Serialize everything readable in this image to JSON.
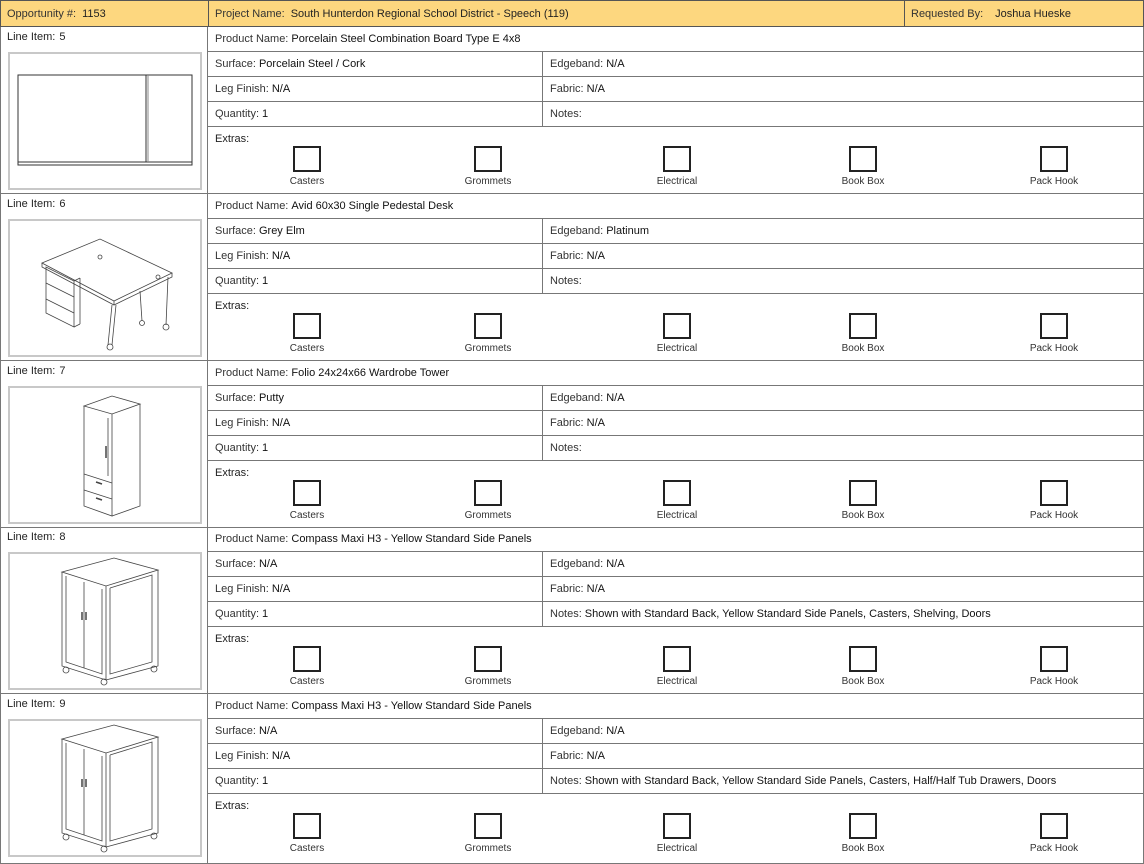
{
  "header": {
    "opportunity_label": "Opportunity #:",
    "opportunity_value": "1153",
    "project_label": "Project Name:",
    "project_value": "South Hunterdon Regional School District - Speech (119)",
    "requested_label": "Requested By:",
    "requested_value": "Joshua Hueske"
  },
  "labels": {
    "line_item": "Line Item:",
    "product_name": "Product Name:",
    "surface": "Surface:",
    "edgeband": "Edgeband:",
    "leg_finish": "Leg Finish:",
    "fabric": "Fabric:",
    "quantity": "Quantity:",
    "notes": "Notes:",
    "extras": "Extras:"
  },
  "extras_options": [
    "Casters",
    "Grommets",
    "Electrical",
    "Book Box",
    "Pack Hook"
  ],
  "items": [
    {
      "line_item": "5",
      "product_name": "Porcelain Steel Combination Board Type E 4x8",
      "surface": "Porcelain Steel / Cork",
      "edgeband": "N/A",
      "leg_finish": "N/A",
      "fabric": "N/A",
      "quantity": "1",
      "notes": "",
      "image": "board-drawing"
    },
    {
      "line_item": "6",
      "product_name": "Avid 60x30 Single Pedestal Desk",
      "surface": "Grey Elm",
      "edgeband": "Platinum",
      "leg_finish": "N/A",
      "fabric": "N/A",
      "quantity": "1",
      "notes": "",
      "image": "desk-drawing"
    },
    {
      "line_item": "7",
      "product_name": "Folio 24x24x66 Wardrobe Tower",
      "surface": "Putty",
      "edgeband": "N/A",
      "leg_finish": "N/A",
      "fabric": "N/A",
      "quantity": "1",
      "notes": "",
      "image": "wardrobe-drawing"
    },
    {
      "line_item": "8",
      "product_name": "Compass Maxi H3 - Yellow Standard Side Panels",
      "surface": "N/A",
      "edgeband": "N/A",
      "leg_finish": "N/A",
      "fabric": "N/A",
      "quantity": "1",
      "notes": "Shown with Standard Back, Yellow Standard Side Panels, Casters, Shelving, Doors",
      "image": "cabinet-drawing"
    },
    {
      "line_item": "9",
      "product_name": "Compass Maxi H3 - Yellow Standard Side Panels",
      "surface": "N/A",
      "edgeband": "N/A",
      "leg_finish": "N/A",
      "fabric": "N/A",
      "quantity": "1",
      "notes": "Shown with Standard Back, Yellow Standard Side Panels, Casters, Half/Half Tub Drawers, Doors",
      "image": "cabinet-drawing"
    }
  ]
}
